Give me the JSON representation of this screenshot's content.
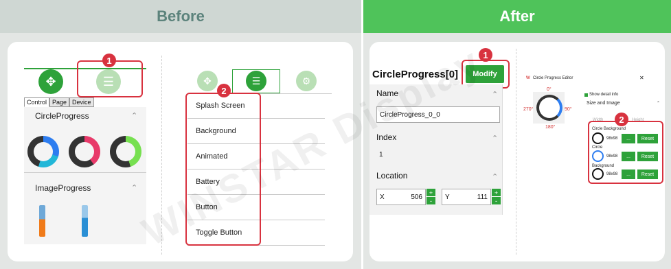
{
  "before": {
    "title": "Before",
    "tabs": [
      "Control",
      "Page",
      "Device"
    ],
    "sections": [
      "CircleProgress",
      "ImageProgress"
    ],
    "badges": [
      "1",
      "2"
    ],
    "menu_items": [
      "Splash Screen",
      "Background",
      "Animated",
      "Battery",
      "Button",
      "Toggle Button"
    ],
    "colors": {
      "accent": "#2ea23a",
      "highlight": "#d8323f"
    }
  },
  "after": {
    "title": "After",
    "header": "CircleProgress[0]",
    "modify_label": "Modify",
    "badges": [
      "1",
      "2"
    ],
    "name_label": "Name",
    "name_value": "CircleProgress_0_0",
    "index_label": "Index",
    "index_value": "1",
    "location_label": "Location",
    "x_label": "X",
    "x_value": "506",
    "y_label": "Y",
    "y_value": "111",
    "stepper_plus": "+",
    "stepper_minus": "-",
    "editor": {
      "title": "Circle Progress Editor",
      "angles": [
        "0°",
        "90°",
        "180°",
        "270°"
      ],
      "show_detail": "Show detail info",
      "size_image": "Size and Image",
      "width_label": "Width",
      "height_label": "Height",
      "groups": [
        {
          "name": "Circle Background",
          "size": "98x98",
          "browse": "...",
          "reset": "Reset"
        },
        {
          "name": "Circle",
          "size": "98x98",
          "browse": "...",
          "reset": "Reset"
        },
        {
          "name": "Background",
          "size": "98x98",
          "browse": "...",
          "reset": "Reset"
        }
      ]
    }
  },
  "watermark": "WINSTAR Display"
}
